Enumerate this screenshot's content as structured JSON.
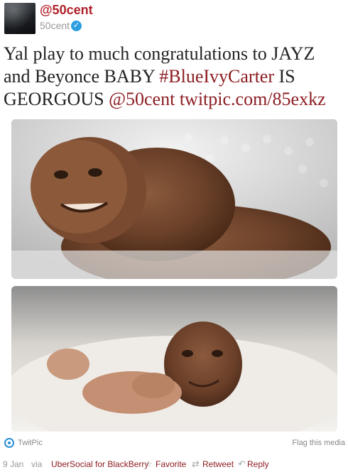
{
  "author": {
    "screen_name": "@50cent",
    "username": "50cent",
    "verified_icon": "verified-icon"
  },
  "tweet": {
    "text_plain": "Yal play to much congratulations to JAYZ and Beyonce BABY",
    "hashtag": "#BlueIvyCarter",
    "text_after_hashtag": "IS GEORGOUS",
    "mention": "@50cent",
    "link": "twitpic.com/85exkz"
  },
  "media": {
    "provider": "TwitPic",
    "flag_label": "Flag this media",
    "images": [
      {
        "alt": "photo-1"
      },
      {
        "alt": "photo-2"
      }
    ]
  },
  "footer": {
    "date": "9 Jan",
    "via": "via",
    "client": "UberSocial for BlackBerry",
    "favorite": "Favorite",
    "retweet": "Retweet",
    "reply": "Reply"
  },
  "colors": {
    "accent": "#8c1d22",
    "name": "#b0202a",
    "twitpic": "#2a8fd6"
  }
}
